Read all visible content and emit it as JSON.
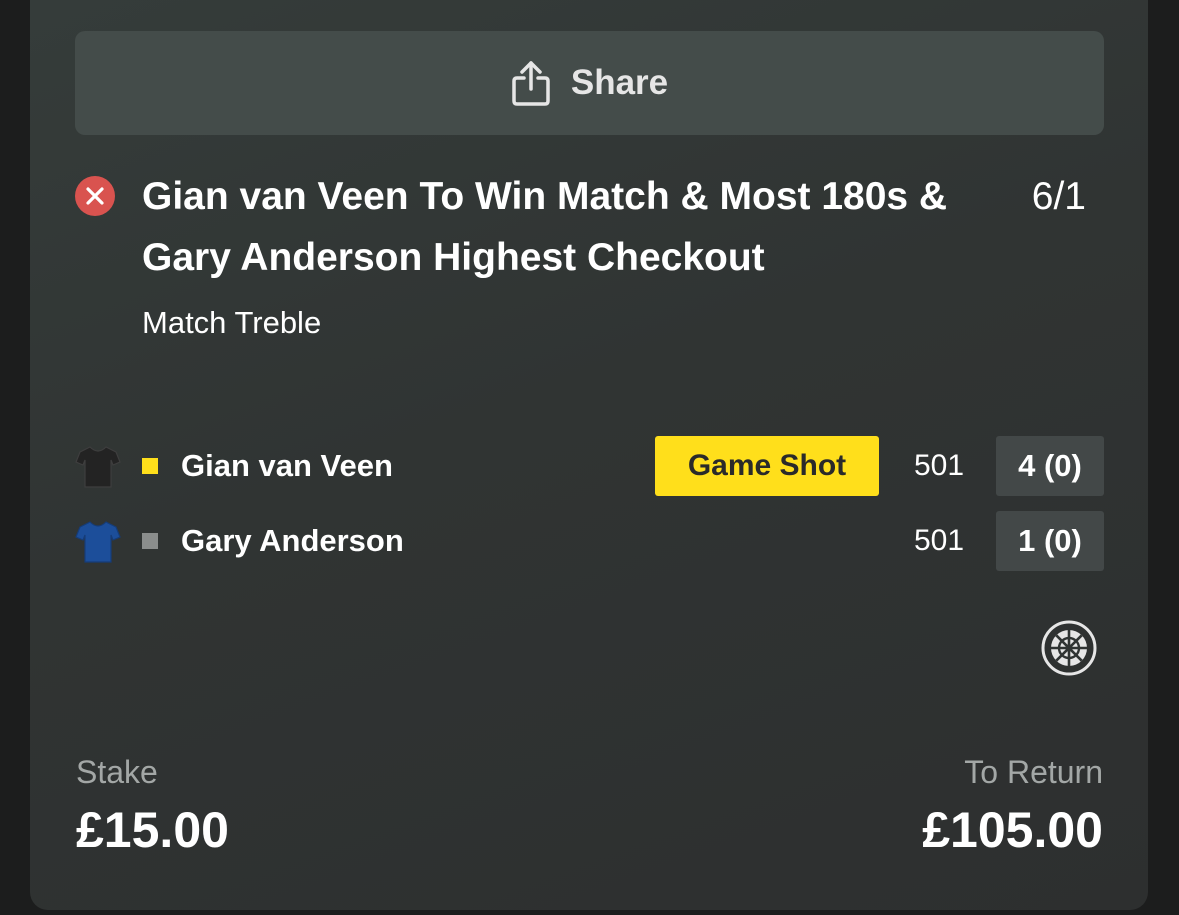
{
  "share": {
    "label": "Share",
    "icon": "share-icon"
  },
  "selection": {
    "status_icon": "close-circle-icon",
    "status_color": "#d9534f",
    "title": "Gian van Veen To Win Match & Most 180s & Gary Anderson Highest Checkout",
    "odds": "6/1",
    "market": "Match Treble"
  },
  "scoreboard": {
    "players": [
      {
        "name": "Gian van Veen",
        "shirt_color": "#232323",
        "indicator_color": "#ffdf1b",
        "badge": "Game Shot",
        "score": "501",
        "legs": "4 (0)"
      },
      {
        "name": "Gary Anderson",
        "shirt_color": "#1c4e9a",
        "indicator_color": "#8a8d8c",
        "score": "501",
        "legs": "1 (0)"
      }
    ],
    "sport_icon": "dartboard-icon"
  },
  "stake": {
    "label": "Stake",
    "value": "£15.00"
  },
  "to_return": {
    "label": "To Return",
    "value": "£105.00"
  },
  "colors": {
    "accent_yellow": "#ffdf1b",
    "card_bg": "#303433",
    "lost_red": "#d9534f"
  }
}
